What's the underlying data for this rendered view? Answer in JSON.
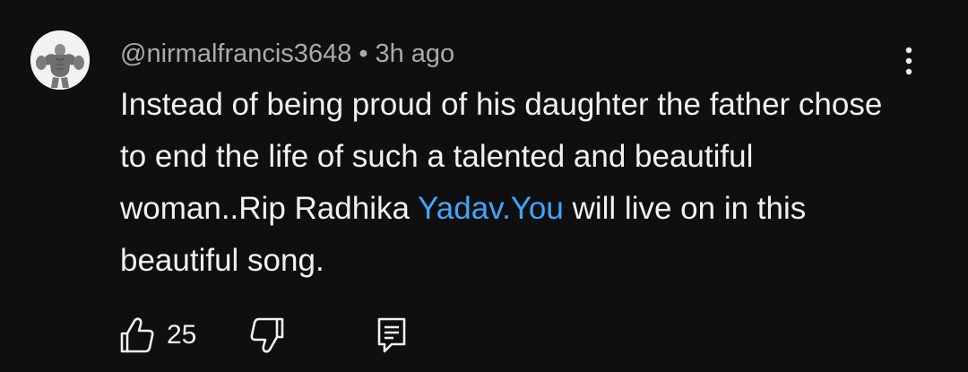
{
  "comment": {
    "author": "@nirmalfrancis3648",
    "separator": "•",
    "time": "3h ago",
    "text_part1": "Instead of being proud of his daughter the father chose to end the life of such a talented and beautiful woman..Rip Radhika ",
    "link_text": "Yadav.You",
    "text_part2": " will live on in this beautiful song.",
    "like_count": "25"
  },
  "colors": {
    "background": "#0f0f0f",
    "text": "#f1f1f1",
    "secondary_text": "#aaaaaa",
    "link": "#3ea6ff"
  },
  "icons": {
    "avatar": "hulk-avatar",
    "menu": "kebab-menu-icon",
    "like": "thumbs-up-icon",
    "dislike": "thumbs-down-icon",
    "reply": "reply-comment-icon"
  }
}
